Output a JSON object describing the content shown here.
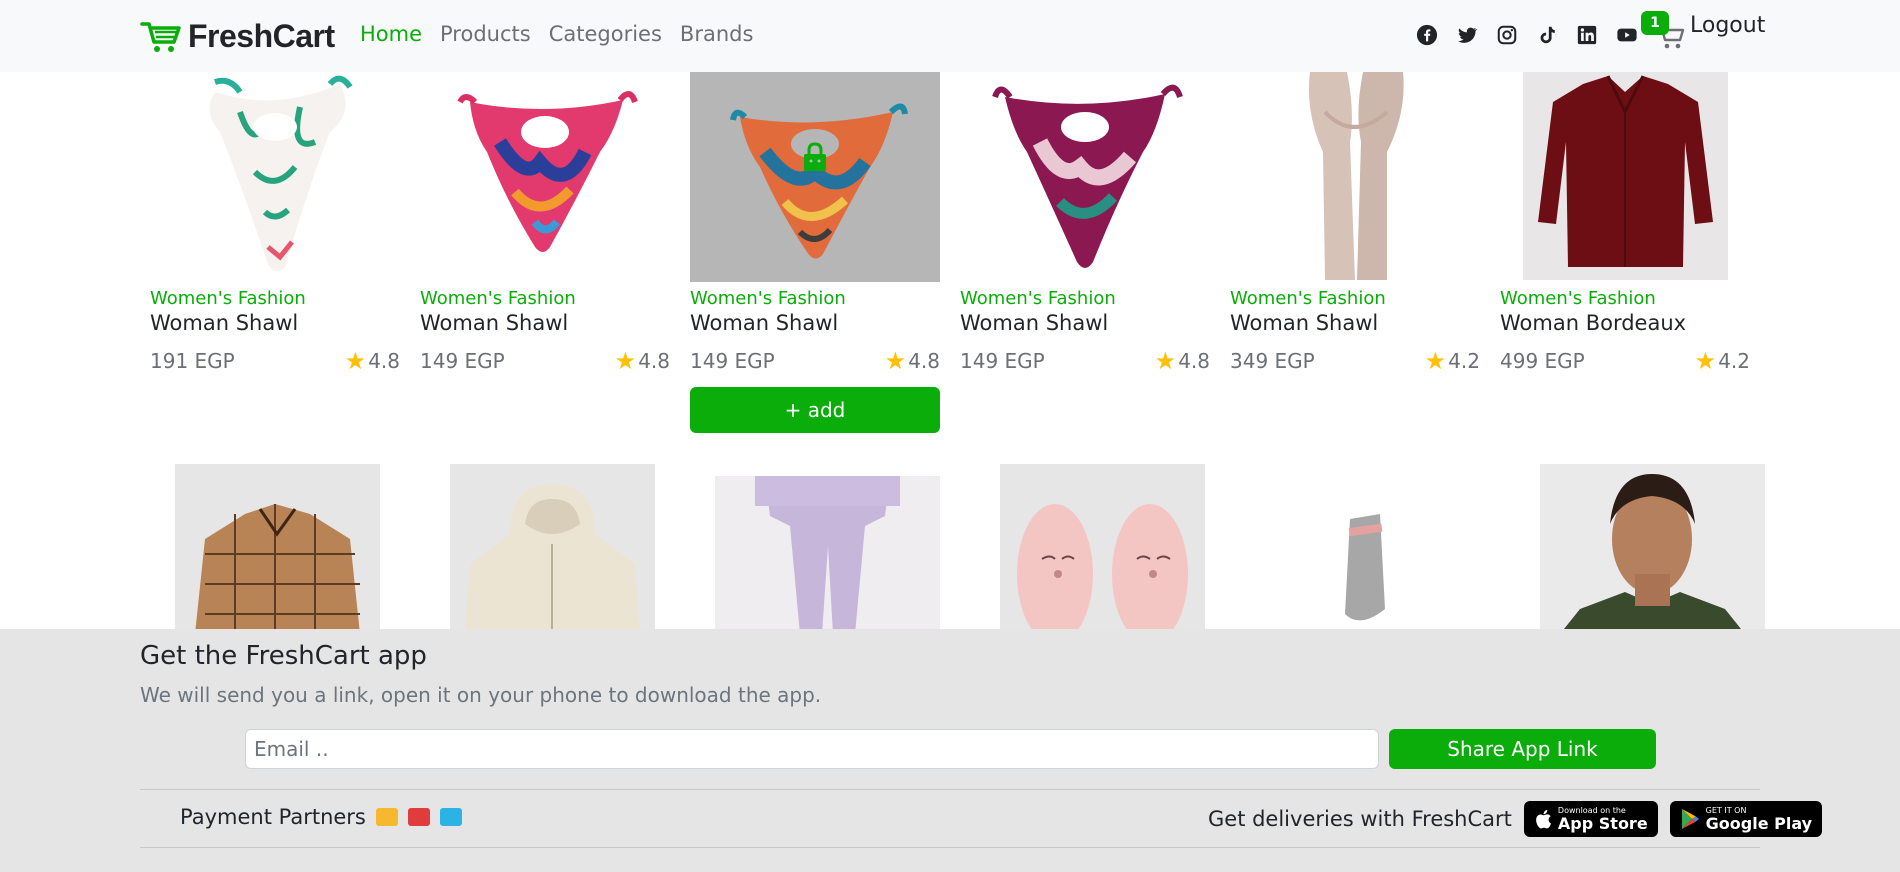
{
  "navbar": {
    "brand": "FreshCart",
    "links": [
      {
        "label": "Home",
        "active": true
      },
      {
        "label": "Products",
        "active": false
      },
      {
        "label": "Categories",
        "active": false
      },
      {
        "label": "Brands",
        "active": false
      }
    ],
    "socials": [
      "facebook-icon",
      "twitter-icon",
      "instagram-icon",
      "tiktok-icon",
      "linkedin-icon",
      "youtube-icon"
    ],
    "cart_count": "1",
    "logout_label": "Logout",
    "accent_color": "#0aad0a"
  },
  "products_row_1": [
    {
      "category": "Women's Fashion",
      "title": "Woman Shawl",
      "price": "191 EGP",
      "rating": "4.8"
    },
    {
      "category": "Women's Fashion",
      "title": "Woman Shawl",
      "price": "149 EGP",
      "rating": "4.8"
    },
    {
      "category": "Women's Fashion",
      "title": "Woman Shawl",
      "price": "149 EGP",
      "rating": "4.8",
      "add_label": "+ add"
    },
    {
      "category": "Women's Fashion",
      "title": "Woman Shawl",
      "price": "149 EGP",
      "rating": "4.8"
    },
    {
      "category": "Women's Fashion",
      "title": "Woman Shawl",
      "price": "349 EGP",
      "rating": "4.2"
    },
    {
      "category": "Women's Fashion",
      "title": "Woman Bordeaux",
      "price": "499 EGP",
      "rating": "4.2"
    }
  ],
  "footer": {
    "title": "Get the FreshCart app",
    "subtitle": "We will send you a link, open it on your phone to download the app.",
    "email_placeholder": "Email ..",
    "share_label": "Share App Link",
    "payment_label": "Payment Partners",
    "payment_icons": [
      "amazon-pay-icon",
      "mastercard-icon",
      "paypal-icon"
    ],
    "deliveries_label": "Get deliveries with FreshCart",
    "app_store": {
      "small": "Download on the",
      "big": "App Store"
    },
    "google_play": {
      "small": "GET IT ON",
      "big": "Google Play"
    }
  }
}
